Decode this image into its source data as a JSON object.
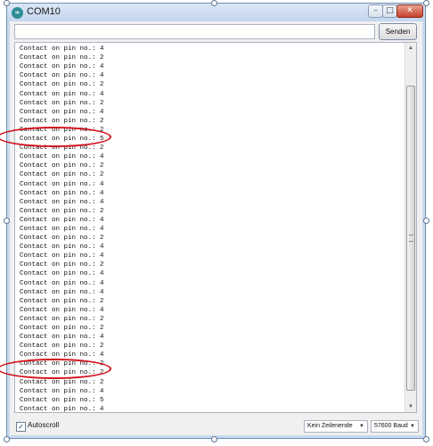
{
  "window": {
    "title": "COM10",
    "icon": "arduino-icon",
    "icon_text": "∞"
  },
  "controls": {
    "minimize": "–",
    "maximize": "□",
    "close": "✕"
  },
  "send": {
    "input_value": "",
    "button_label": "Senden"
  },
  "output": {
    "lines": [
      "Contact on pin no.: 4",
      "Contact on pin no.: 4",
      "Contact on pin no.: 2",
      "Contact on pin no.: 4",
      "Contact on pin no.: 4",
      "Contact on pin no.: 2",
      "Contact on pin no.: 4",
      "Contact on pin no.: 2",
      "Contact on pin no.: 4",
      "Contact on pin no.: 2",
      "Contact on pin no.: 2",
      "Contact on pin no.: 5",
      "Contact on pin no.: 2",
      "Contact on pin no.: 4",
      "Contact on pin no.: 2",
      "Contact on pin no.: 2",
      "Contact on pin no.: 4",
      "Contact on pin no.: 4",
      "Contact on pin no.: 4",
      "Contact on pin no.: 2",
      "Contact on pin no.: 4",
      "Contact on pin no.: 4",
      "Contact on pin no.: 2",
      "Contact on pin no.: 4",
      "Contact on pin no.: 4",
      "Contact on pin no.: 2",
      "Contact on pin no.: 4",
      "Contact on pin no.: 4",
      "Contact on pin no.: 4",
      "Contact on pin no.: 2",
      "Contact on pin no.: 4",
      "Contact on pin no.: 2",
      "Contact on pin no.: 2",
      "Contact on pin no.: 4",
      "Contact on pin no.: 2",
      "Contact on pin no.: 4",
      "Contact on pin no.: 2",
      "Contact on pin no.: 2",
      "Contact on pin no.: 2",
      "Contact on pin no.: 4",
      "Contact on pin no.: 5",
      "Contact on pin no.: 4",
      "Contact on pin no.: 4",
      "Contact on pin no.: 4",
      "Contact on pin no.: 2",
      "Contact on pin no.: 4"
    ],
    "highlighted_color": "#d4121c"
  },
  "bottom": {
    "autoscroll_checked": true,
    "autoscroll_check_glyph": "✓",
    "autoscroll_label": "Autoscroll",
    "line_ending": "Kein Zeilenende",
    "baud": "57600 Baud",
    "caret": "▼"
  },
  "scroll": {
    "up": "▲",
    "down": "▼"
  }
}
